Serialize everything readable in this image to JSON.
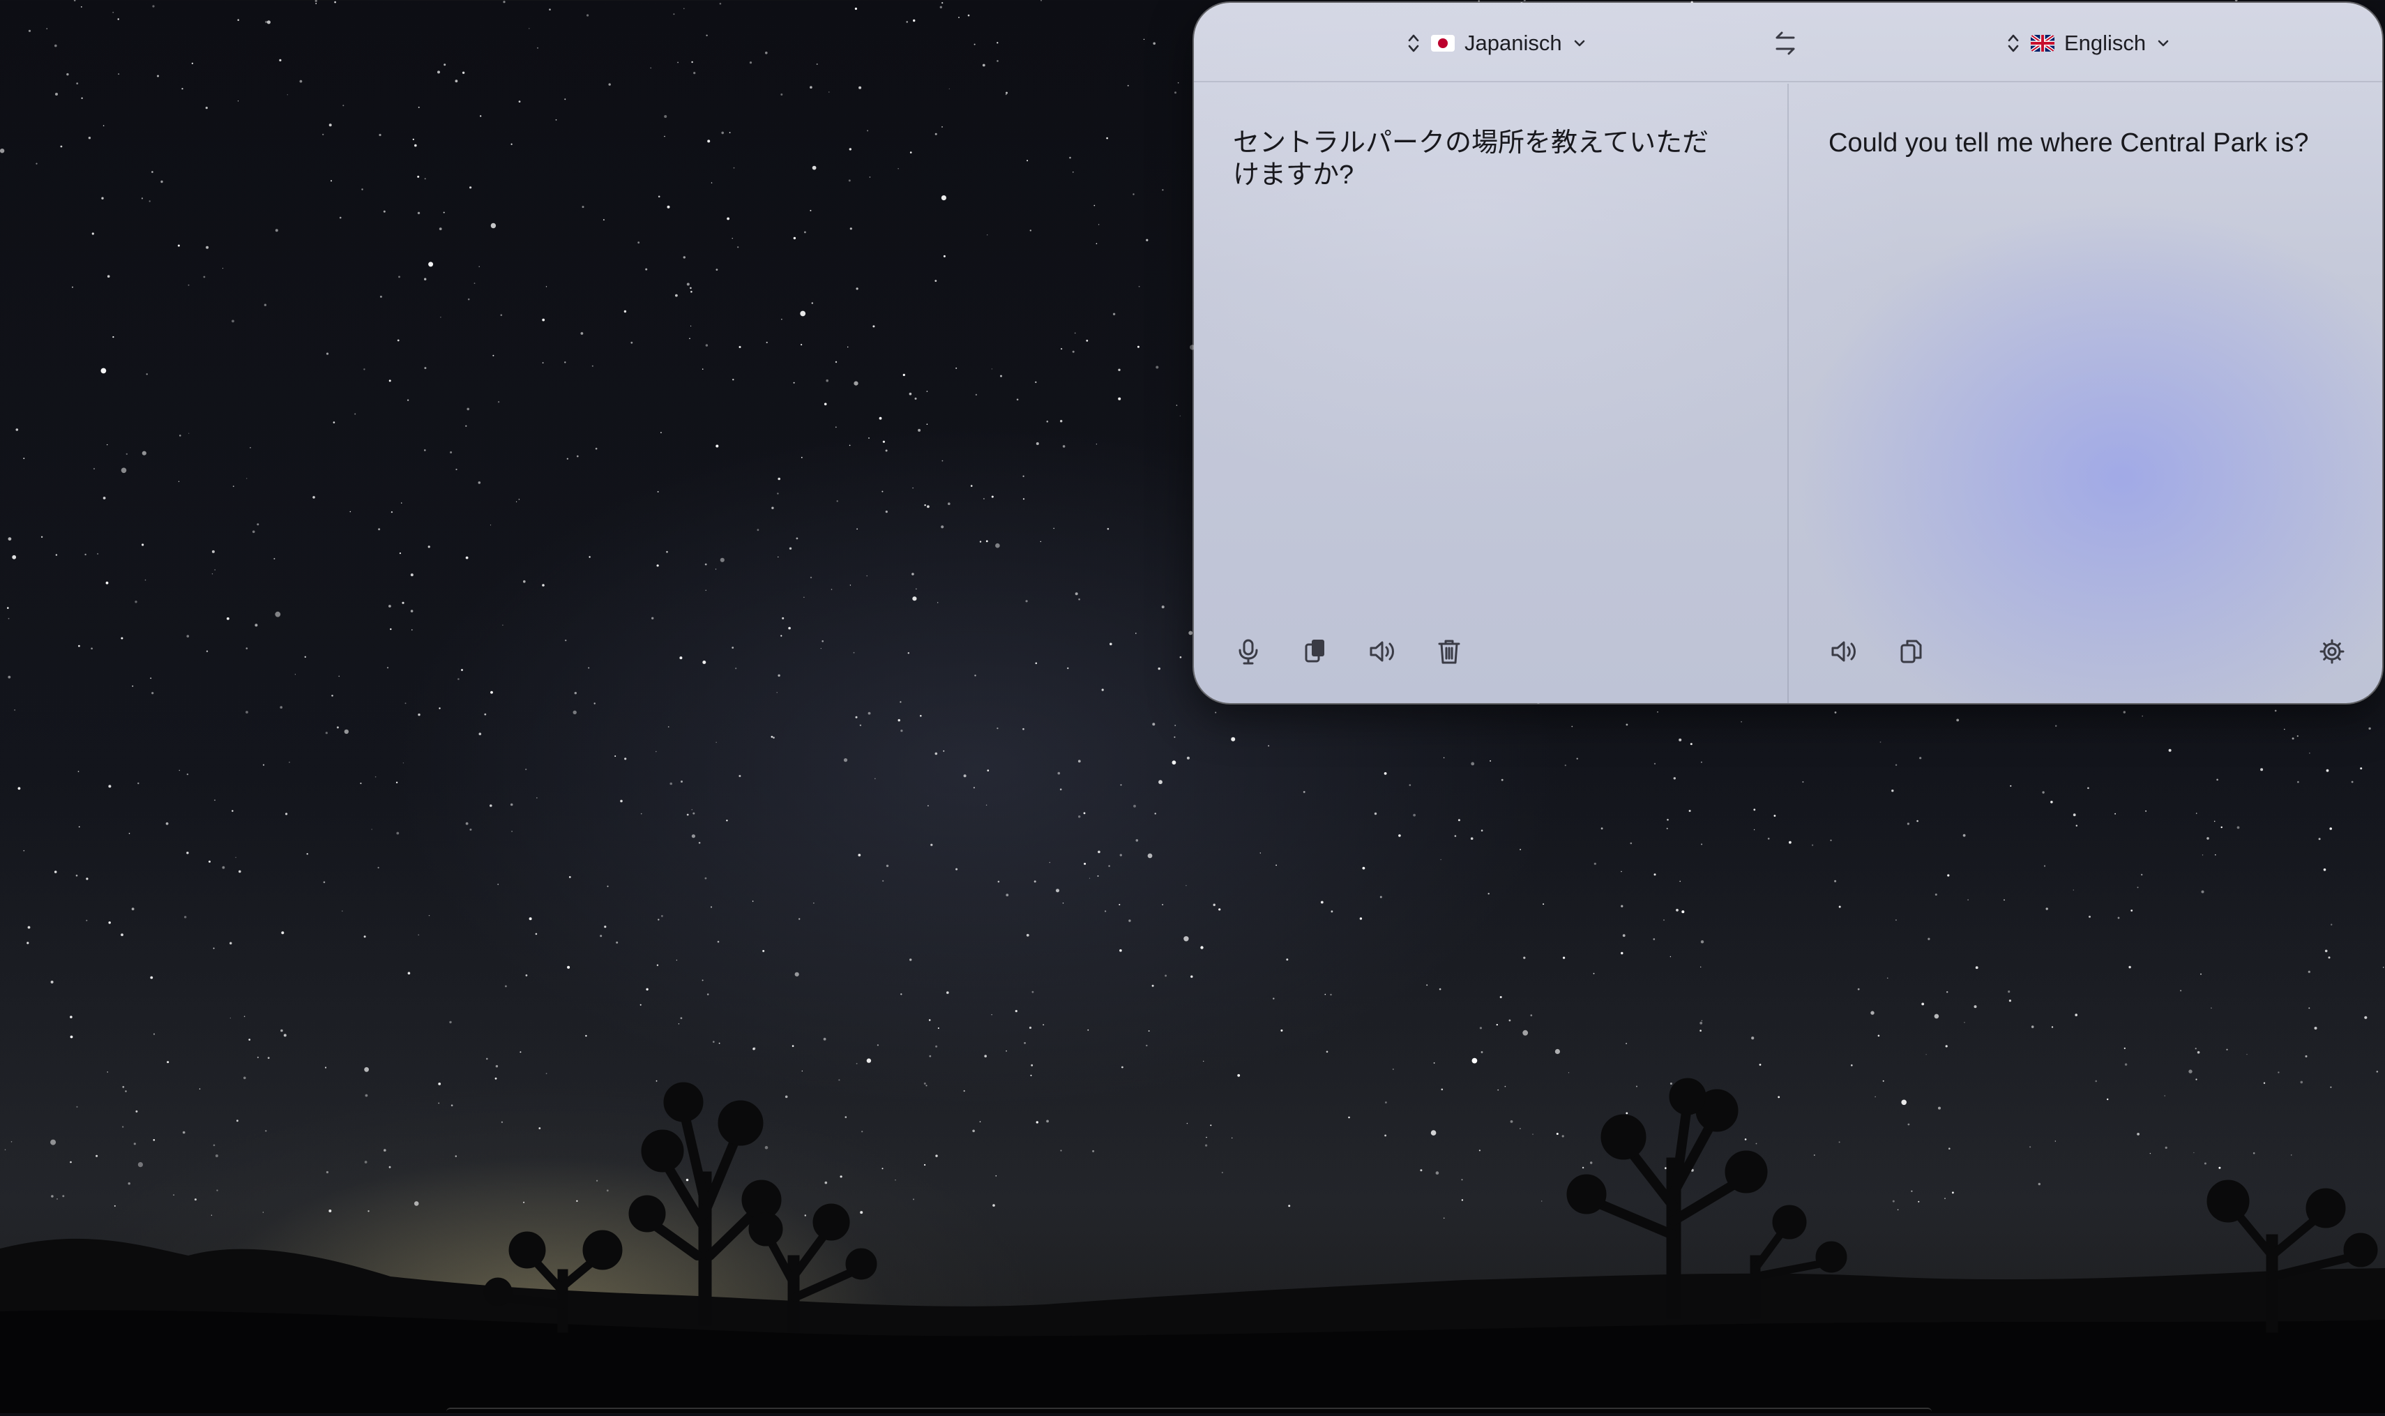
{
  "translator": {
    "source_language": {
      "name": "Japanisch",
      "flag": "japan-flag"
    },
    "target_language": {
      "name": "Englisch",
      "flag": "uk-flag"
    },
    "source_text": "セントラルパークの場所を教えていただけますか?",
    "translated_text": "Could you tell me where Central Park is?",
    "source_actions": [
      "microphone-icon",
      "paste-icon",
      "speaker-icon",
      "trash-icon"
    ],
    "target_actions": [
      "speaker-icon",
      "copy-icon"
    ],
    "settings": "gear-icon"
  },
  "colors": {
    "panel_background": "#c5c9d9",
    "text": "#18181d",
    "icon": "#3a3b45"
  }
}
